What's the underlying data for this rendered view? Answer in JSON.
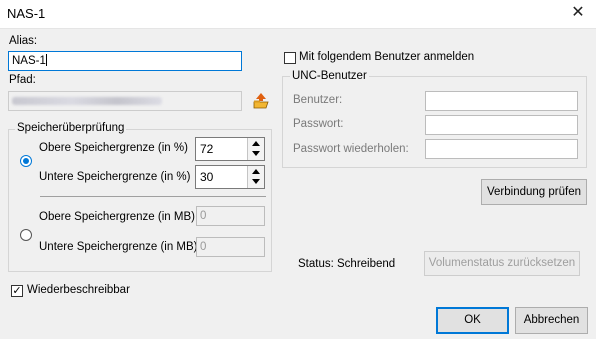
{
  "window": {
    "title": "NAS-1",
    "close_glyph": "✕"
  },
  "alias": {
    "label": "Alias:",
    "value": "NAS-1"
  },
  "path": {
    "label": "Pfad:",
    "value_obscured": true,
    "browse_icon": "folder-browse-icon"
  },
  "storage_check": {
    "group_label": "Speicherüberprüfung",
    "percent_mode": {
      "selected": true,
      "upper_label": "Obere Speichergrenze (in %)",
      "upper_value": "72",
      "lower_label": "Untere Speichergrenze (in %)",
      "lower_value": "30"
    },
    "mb_mode": {
      "selected": false,
      "upper_label": "Obere Speichergrenze (in MB)",
      "upper_value": "0",
      "lower_label": "Untere Speichergrenze (in MB)",
      "lower_value": "0"
    }
  },
  "rewritable": {
    "label": "Wiederbeschreibbar",
    "checked": true,
    "check_glyph": "✓"
  },
  "user_login": {
    "label": "Mit folgendem Benutzer anmelden",
    "checked": false
  },
  "unc": {
    "group_label": "UNC-Benutzer",
    "user_label": "Benutzer:",
    "password_label": "Passwort:",
    "password_repeat_label": "Passwort wiederholen:"
  },
  "verify_button": "Verbindung prüfen",
  "status": {
    "label": "Status:",
    "value": "Schreibend"
  },
  "reset_button": "Volumenstatus zurücksetzen",
  "footer": {
    "ok": "OK",
    "cancel": "Abbrechen"
  },
  "colors": {
    "accent": "#0078d7",
    "window_bg": "#f0f0f0",
    "titlebar_bg": "#ffffff"
  }
}
